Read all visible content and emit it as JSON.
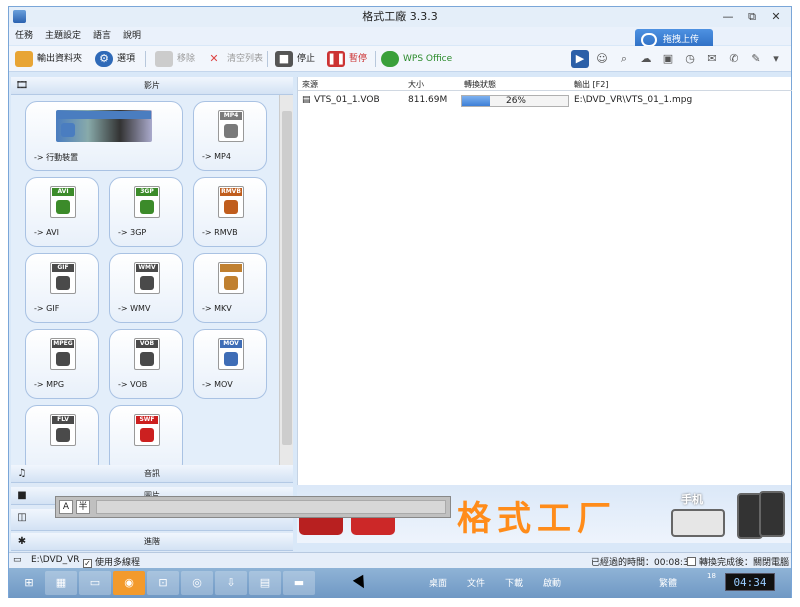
{
  "window": {
    "title": "格式工廠 3.3.3",
    "min": "—",
    "restore": "⧉",
    "close": "✕"
  },
  "menu": [
    "任務",
    "主題設定",
    "語言",
    "說明"
  ],
  "upload": {
    "label": "拖拽上传"
  },
  "toolbar": {
    "output_folder": "輸出資料夾",
    "options": "選項",
    "remove": "移除",
    "clear_list": "清空列表",
    "stop": "停止",
    "pause": "暫停",
    "wps": "WPS Office"
  },
  "left": {
    "video_header": "影片",
    "audio_header": "音訊",
    "image_header": "圖片",
    "advanced_header": "進階"
  },
  "tiles": [
    {
      "label": "-> 行動裝置",
      "badge": "",
      "color": "#4a7dc0"
    },
    {
      "label": "-> MP4",
      "badge": "MP4",
      "color": "#7a7a7a"
    },
    {
      "label": "-> AVI",
      "badge": "AVI",
      "color": "#3c8b2a"
    },
    {
      "label": "-> 3GP",
      "badge": "3GP",
      "color": "#3c8b2a"
    },
    {
      "label": "-> RMVB",
      "badge": "RMVB",
      "color": "#c05d1d"
    },
    {
      "label": "-> GIF",
      "badge": "GIF",
      "color": "#4a4a4a"
    },
    {
      "label": "-> WMV",
      "badge": "WMV",
      "color": "#4a4a4a"
    },
    {
      "label": "-> MKV",
      "badge": "",
      "color": "#c08030"
    },
    {
      "label": "-> MPG",
      "badge": "MPEG",
      "color": "#4a4a4a"
    },
    {
      "label": "-> VOB",
      "badge": "VOB",
      "color": "#4a4a4a"
    },
    {
      "label": "-> MOV",
      "badge": "MOV",
      "color": "#3f6db6"
    },
    {
      "label": "",
      "badge": "FLV",
      "color": "#4a4a4a"
    },
    {
      "label": "",
      "badge": "SWF",
      "color": "#cc2020"
    }
  ],
  "list": {
    "headers": {
      "source": "來源",
      "size": "大小",
      "status": "轉換狀態",
      "output": "輸出 [F2]"
    },
    "rows": [
      {
        "source": "VTS_01_1.VOB",
        "size": "811.69M",
        "progress": "26%",
        "progress_value": 0.26,
        "output": "E:\\DVD_VR\\VTS_01_1.mpg"
      }
    ]
  },
  "banner": {
    "text": "格式工厂",
    "phone_label": "手机"
  },
  "ime": {
    "a": "A",
    "half": "半"
  },
  "status": {
    "path": "E:\\DVD_VR",
    "multithread": "使用多線程",
    "elapsed": "已經過的時間：00:08:31",
    "after_done": "轉換完成後：關閉電腦"
  },
  "taskbar": {
    "desktop": "桌面",
    "files": "文件",
    "downloads": "下載",
    "start": "啟動",
    "lang": "繁體",
    "small": "18",
    "clock": "04:34"
  }
}
